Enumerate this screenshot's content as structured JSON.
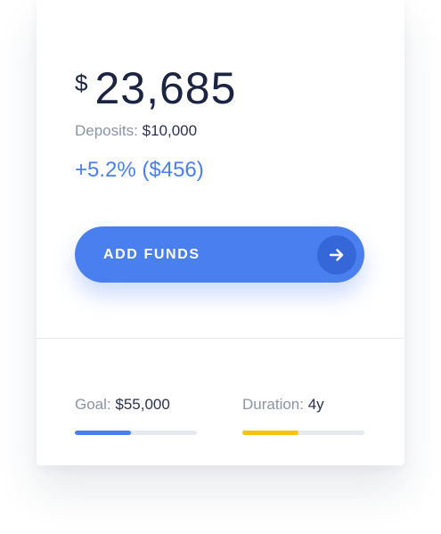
{
  "balance": {
    "currency": "$",
    "amount": "23,685"
  },
  "deposits": {
    "label": "Deposits:",
    "value": "$10,000"
  },
  "gain": {
    "text": "+5.2% ($456)"
  },
  "add_funds": {
    "label": "ADD FUNDS",
    "icon": "arrow-right-icon"
  },
  "goal": {
    "label": "Goal:",
    "value": "$55,000",
    "progress": 0.46,
    "color": "#4a7ff0"
  },
  "duration": {
    "label": "Duration:",
    "value": "4y",
    "progress": 0.46,
    "color": "#f5c211"
  },
  "colors": {
    "accent": "#4a7ff0",
    "accent_dark": "#3567d8",
    "text_dark": "#1b2440",
    "text_muted": "#8a94a6"
  }
}
